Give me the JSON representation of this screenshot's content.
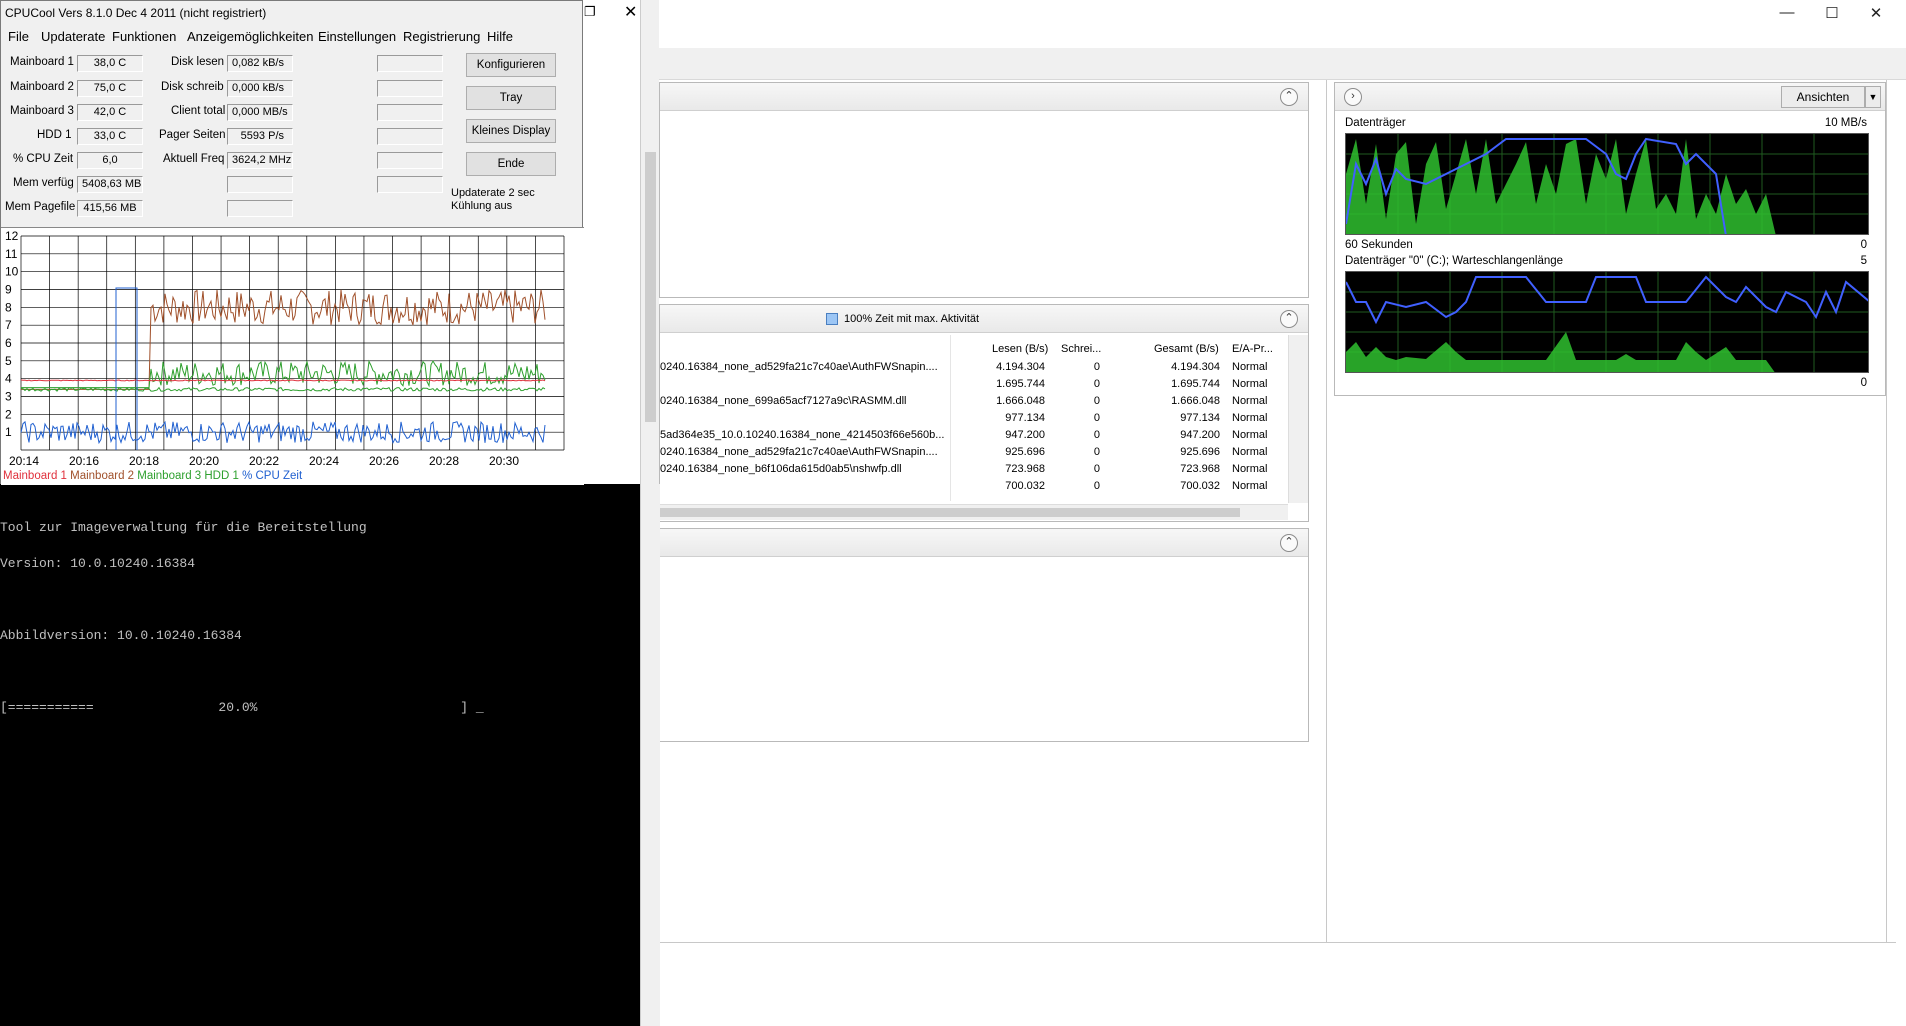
{
  "cpucool": {
    "title": "CPUCool  Vers 8.1.0  Dec  4 2011 (nicht registriert)",
    "menu": [
      "File",
      "Updaterate",
      "Funktionen",
      "Anzeigemöglichkeiten",
      "Einstellungen",
      "Registrierung",
      "Hilfe"
    ],
    "sensors": [
      {
        "label": "Mainboard 1",
        "value": "38,0 C"
      },
      {
        "label": "Mainboard 2",
        "value": "75,0 C"
      },
      {
        "label": "Mainboard 3",
        "value": "42,0 C"
      },
      {
        "label": "HDD 1",
        "value": "33,0 C"
      },
      {
        "label": "% CPU Zeit",
        "value": "6,0"
      },
      {
        "label": "Mem verfüg",
        "value": "5408,63 MB"
      },
      {
        "label": "Mem Pagefile",
        "value": "415,56 MB"
      }
    ],
    "stats": [
      {
        "label": "Disk lesen",
        "value": "0,082 kB/s"
      },
      {
        "label": "Disk schreib",
        "value": "0,000 kB/s"
      },
      {
        "label": "Client total",
        "value": "0,000 MB/s"
      },
      {
        "label": "Pager Seiten",
        "value": "5593 P/s"
      },
      {
        "label": "Aktuell Freq",
        "value": "3624,2 MHz"
      }
    ],
    "buttons": [
      "Konfigurieren",
      "Tray",
      "Kleines Display",
      "Ende"
    ],
    "status": [
      "Updaterate 2 sec",
      "Kühlung aus"
    ],
    "graph": {
      "y_ticks": [
        "12",
        "11",
        "10",
        "9",
        "8",
        "7",
        "6",
        "5",
        "4",
        "3",
        "2",
        "1"
      ],
      "x_ticks": [
        "20:14",
        "20:16",
        "20:18",
        "20:20",
        "20:22",
        "20:24",
        "20:26",
        "20:28",
        "20:30"
      ],
      "legend": [
        {
          "name": "Mainboard 1",
          "color": "#e0303c"
        },
        {
          "name": "Mainboard 2",
          "color": "#a0502a"
        },
        {
          "name": "Mainboard 3",
          "color": "#2ea02e"
        },
        {
          "name": "HDD 1",
          "color": "#2ea02e"
        },
        {
          "name": "% CPU Zeit",
          "color": "#2060d0"
        }
      ]
    }
  },
  "cmd": {
    "lines": [
      "Tool zur Imageverwaltung für die Bereitstellung",
      "Version: 10.0.10240.16384",
      "",
      "Abbildversion: 10.0.10240.16384",
      "",
      "[===========                20.0%                          ] _"
    ]
  },
  "resmon": {
    "disk_panel_title": "100% Zeit mit max. Aktivität",
    "columns": [
      "Lesen (B/s)",
      "Schrei...",
      "Gesamt (B/s)",
      "E/A-Pr..."
    ],
    "rows": [
      {
        "file": "0240.16384_none_ad529fa21c7c40ae\\AuthFWSnapin....",
        "read": "4.194.304",
        "write": "0",
        "total": "4.194.304",
        "prio": "Normal"
      },
      {
        "file": "",
        "read": "1.695.744",
        "write": "0",
        "total": "1.695.744",
        "prio": "Normal"
      },
      {
        "file": "0240.16384_none_699a65acf7127a9c\\RASMM.dll",
        "read": "1.666.048",
        "write": "0",
        "total": "1.666.048",
        "prio": "Normal"
      },
      {
        "file": "",
        "read": "977.134",
        "write": "0",
        "total": "977.134",
        "prio": "Normal"
      },
      {
        "file": "5ad364e35_10.0.10240.16384_none_4214503f66e560b...",
        "read": "947.200",
        "write": "0",
        "total": "947.200",
        "prio": "Normal"
      },
      {
        "file": "0240.16384_none_ad529fa21c7c40ae\\AuthFWSnapin....",
        "read": "925.696",
        "write": "0",
        "total": "925.696",
        "prio": "Normal"
      },
      {
        "file": "0240.16384_none_b6f106da615d0ab5\\nshwfp.dll",
        "read": "723.968",
        "write": "0",
        "total": "723.968",
        "prio": "Normal"
      },
      {
        "file": "",
        "read": "700.032",
        "write": "0",
        "total": "700.032",
        "prio": "Normal"
      }
    ],
    "side": {
      "views_button": "Ansichten",
      "graph1": {
        "title": "Datenträger",
        "max": "10 MB/s",
        "footer_left": "60 Sekunden",
        "footer_right": "0"
      },
      "graph2": {
        "title": "Datenträger \"0\" (C:); Warteschlangenlänge",
        "max": "5",
        "footer_right": "0"
      }
    }
  }
}
